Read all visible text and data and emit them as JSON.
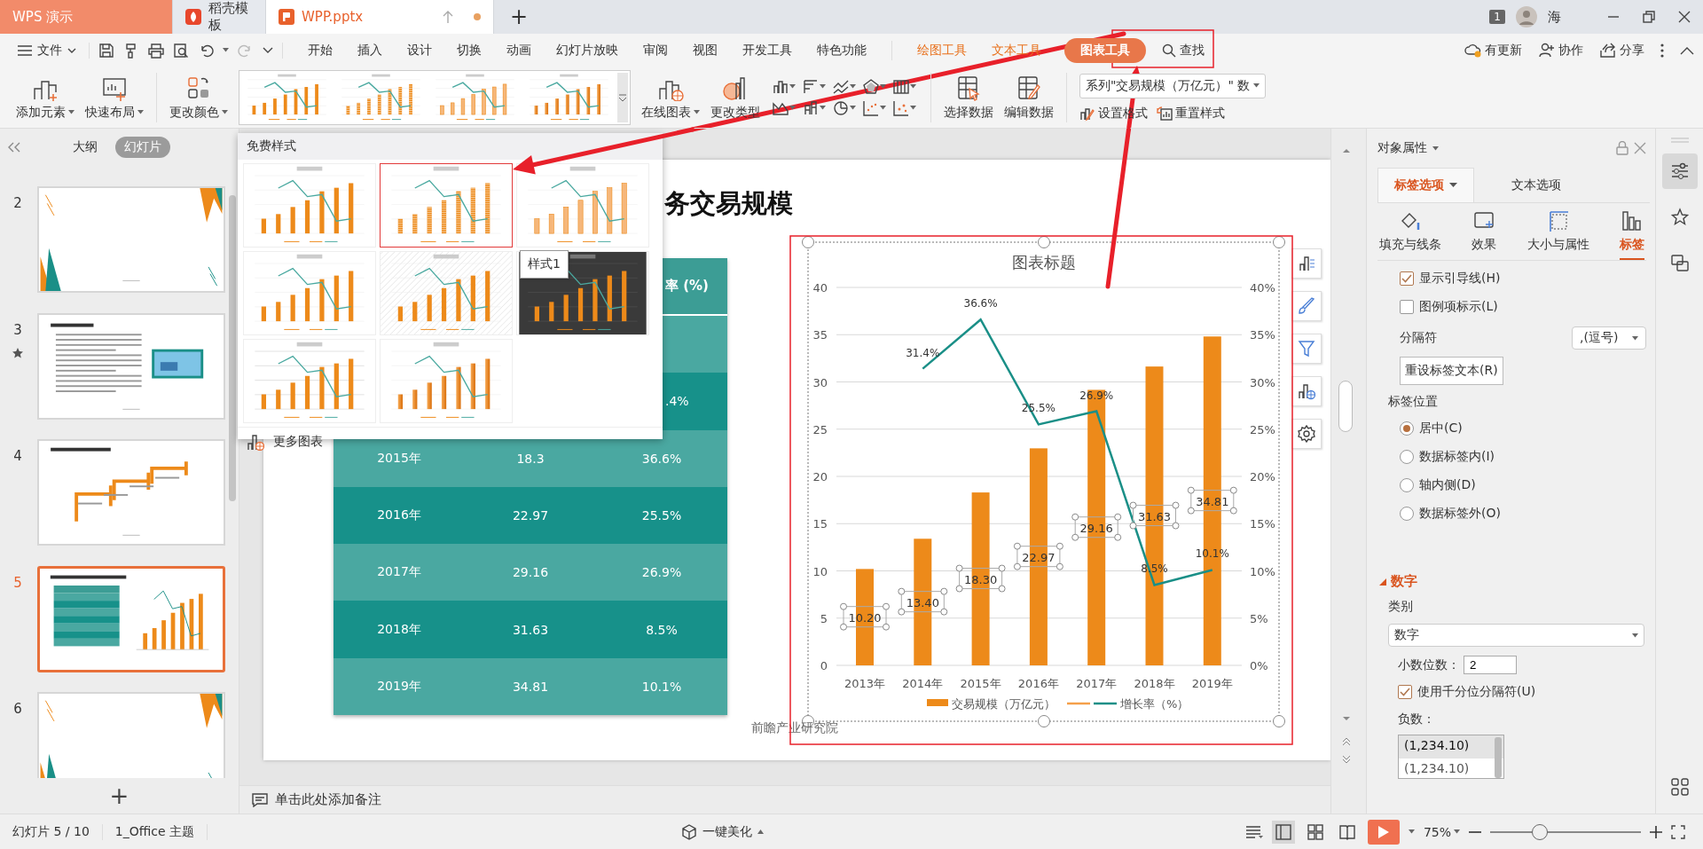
{
  "title_bar": {
    "tabs": [
      {
        "label": "WPS 演示",
        "kind": "app",
        "selected": false
      },
      {
        "label": "稻壳模板",
        "kind": "template",
        "selected": false
      },
      {
        "label": "WPP.pptx",
        "kind": "file",
        "selected": true,
        "modified": true
      }
    ],
    "new_tab": "+",
    "badge": "1",
    "user": "海"
  },
  "menu": {
    "file": "文件",
    "tabs": [
      {
        "label": "开始",
        "kind": "main",
        "selected": false
      },
      {
        "label": "插入",
        "kind": "main",
        "selected": false
      },
      {
        "label": "设计",
        "kind": "main",
        "selected": false
      },
      {
        "label": "切换",
        "kind": "main",
        "selected": false
      },
      {
        "label": "动画",
        "kind": "main",
        "selected": false
      },
      {
        "label": "幻灯片放映",
        "kind": "main",
        "selected": false
      },
      {
        "label": "审阅",
        "kind": "main",
        "selected": false
      },
      {
        "label": "视图",
        "kind": "main",
        "selected": false
      },
      {
        "label": "开发工具",
        "kind": "main",
        "selected": false
      },
      {
        "label": "特色功能",
        "kind": "main",
        "selected": false
      },
      {
        "label": "绘图工具",
        "kind": "context",
        "selected": false
      },
      {
        "label": "文本工具",
        "kind": "context",
        "selected": false
      },
      {
        "label": "图表工具",
        "kind": "context",
        "selected": true
      }
    ],
    "search": "查找",
    "actions": [
      {
        "label": "有更新",
        "kind": "update"
      },
      {
        "label": "协作",
        "kind": "share-people"
      },
      {
        "label": "分享",
        "kind": "share"
      }
    ]
  },
  "ribbon": {
    "left": [
      {
        "label": "添加元素",
        "kind": "add"
      },
      {
        "label": "快速布局",
        "kind": "layout"
      },
      {
        "label": "更改颜色",
        "kind": "color"
      }
    ],
    "gallery": [
      {
        "kind": "solid"
      },
      {
        "kind": "striped"
      },
      {
        "kind": "light"
      },
      {
        "kind": "gradient"
      }
    ],
    "chart_buttons": [
      {
        "label": "在线图表",
        "kind": "online"
      },
      {
        "label": "更改类型",
        "kind": "type"
      }
    ],
    "data_buttons": [
      {
        "label": "选择数据",
        "kind": "select"
      },
      {
        "label": "编辑数据",
        "kind": "edit"
      }
    ],
    "series_select": "系列\"交易规模（万亿元）\" 数",
    "format_buttons": [
      {
        "label": "设置格式",
        "kind": "format"
      },
      {
        "label": "重置样式",
        "kind": "reset"
      }
    ]
  },
  "style_dropdown": {
    "heading": "免费样式",
    "styles": [
      {
        "kind": "solid",
        "selected": false
      },
      {
        "kind": "striped",
        "selected": true
      },
      {
        "kind": "light",
        "selected": false
      },
      {
        "kind": "solid",
        "selected": false
      },
      {
        "kind": "hatched",
        "selected": false
      },
      {
        "kind": "dark",
        "selected": false
      },
      {
        "kind": "gridded",
        "selected": false
      },
      {
        "kind": "gradient",
        "selected": false
      }
    ],
    "tooltip": "样式1",
    "more": "更多图表"
  },
  "left_panel": {
    "tabs": [
      {
        "label": "大纲",
        "selected": false
      },
      {
        "label": "幻灯片",
        "selected": true
      }
    ],
    "slides": [
      {
        "number": "2",
        "kind": "blank",
        "selected": false,
        "animated": false
      },
      {
        "number": "3",
        "kind": "text",
        "selected": false,
        "animated": true
      },
      {
        "number": "4",
        "kind": "timeline",
        "selected": false,
        "animated": false
      },
      {
        "number": "5",
        "kind": "chart",
        "selected": true,
        "animated": false
      },
      {
        "number": "6",
        "kind": "blank",
        "selected": false,
        "animated": false
      }
    ],
    "add": "+"
  },
  "slide": {
    "title": "务交易规模",
    "table": {
      "header": {
        "column_3": "率 (%)"
      },
      "rows": [
        {
          "color": "#4aa8a1"
        },
        {
          "color": "#17918a",
          "column_3": ".4%"
        },
        {
          "color": "#4aa8a1",
          "column_1": "2015年",
          "column_2": "18.3",
          "column_3": "36.6%"
        },
        {
          "color": "#17918a",
          "column_1": "2016年",
          "column_2": "22.97",
          "column_3": "25.5%"
        },
        {
          "color": "#4aa8a1",
          "column_1": "2017年",
          "column_2": "29.16",
          "column_3": "26.9%"
        },
        {
          "color": "#17918a",
          "column_1": "2018年",
          "column_2": "31.63",
          "column_3": "8.5%"
        },
        {
          "color": "#4aa8a1",
          "column_1": "2019年",
          "column_2": "34.81",
          "column_3": "10.1%"
        }
      ]
    },
    "chart": {
      "chart_data": {
        "type": "bar",
        "title": "图表标题",
        "categories": [
          "2013年",
          "2014年",
          "2015年",
          "2016年",
          "2017年",
          "2018年",
          "2019年"
        ],
        "series": [
          {
            "name": "交易规模（万亿元）",
            "color": "#ed8a1a",
            "values": [
              10.2,
              13.4,
              18.3,
              22.97,
              29.16,
              31.63,
              34.81
            ],
            "value_labels": [
              "10.20",
              "13.40",
              "18.30",
              "22.97",
              "29.16",
              "31.63",
              "34.81"
            ]
          },
          {
            "name": "增长率（%）",
            "color": "#1a8f87",
            "type": "line",
            "axis": "y2",
            "values": [
              null,
              0.314,
              0.366,
              0.255,
              0.269,
              0.085,
              0.101
            ],
            "value_labels": [
              null,
              "31.4%",
              "36.6%",
              "25.5%",
              "26.9%",
              "8.5%",
              "10.1%"
            ]
          }
        ],
        "legend": [
          {
            "kind": "bar"
          },
          {
            "kind": "line",
            "color": "#f5a04a"
          },
          {
            "kind": "line"
          }
        ],
        "grid": true,
        "ylim": [
          0,
          40
        ],
        "yticks": [
          0,
          5,
          10,
          15,
          20,
          25,
          30,
          35,
          40
        ],
        "y2lim": [
          0,
          0.4
        ],
        "y2ticks": [
          {
            "value": 0,
            "label": "0%"
          },
          {
            "value": 0.05,
            "label": "5%"
          },
          {
            "value": 0.1,
            "label": "10%"
          },
          {
            "value": 0.15,
            "label": "15%"
          },
          {
            "value": 0.2,
            "label": "20%"
          },
          {
            "value": 0.25,
            "label": "25%"
          },
          {
            "value": 0.3,
            "label": "30%"
          },
          {
            "value": 0.35,
            "label": "35%"
          },
          {
            "value": 0.4,
            "label": "40%"
          }
        ]
      }
    },
    "source": "前瞻产业研究院"
  },
  "notes": "单击此处添加备注",
  "right_panel": {
    "title": "对象属性",
    "tabs": [
      {
        "label": "标签选项",
        "selected": true
      },
      {
        "label": "文本选项",
        "selected": false
      }
    ],
    "sub_tabs": [
      {
        "label": "填充与线条",
        "kind": "fill",
        "selected": false
      },
      {
        "label": "效果",
        "kind": "effect",
        "selected": false
      },
      {
        "label": "大小与属性",
        "kind": "size",
        "selected": false
      },
      {
        "label": "标签",
        "kind": "label",
        "selected": true
      }
    ],
    "options": [
      {
        "label": "显示引导线(H)",
        "checked": true
      },
      {
        "label": "图例项标示(L)",
        "checked": false
      }
    ],
    "separator": {
      "label": "分隔符",
      "value": ",(逗号)"
    },
    "reset_button": "重设标签文本(R)",
    "position": {
      "label": "标签位置",
      "options": [
        {
          "label": "居中(C)",
          "selected": true
        },
        {
          "label": "数据标签内(I)",
          "selected": false
        },
        {
          "label": "轴内侧(D)",
          "selected": false
        },
        {
          "label": "数据标签外(O)",
          "selected": false
        }
      ]
    },
    "number": {
      "heading": "数字",
      "expanded": true,
      "category_label": "类别",
      "category": "数字",
      "decimals_label": "小数位数：",
      "decimals": "2",
      "thousands": {
        "label": "使用千分位分隔符(U)",
        "checked": true
      },
      "negative_label": "负数：",
      "negative_options": [
        {
          "label": "(1,234.10)",
          "selected": true
        },
        {
          "label": "(1,234.10)",
          "selected": false
        }
      ]
    }
  },
  "status_bar": {
    "slide": "幻灯片 5 / 10",
    "theme": "1_Office 主题",
    "beautify": "一键美化",
    "views": [
      {
        "kind": "normal",
        "selected": true
      },
      {
        "kind": "sorter",
        "selected": false
      },
      {
        "kind": "reading",
        "selected": false
      }
    ],
    "zoom": "75%",
    "zoom_slider": {
      "level": 0.33
    }
  }
}
